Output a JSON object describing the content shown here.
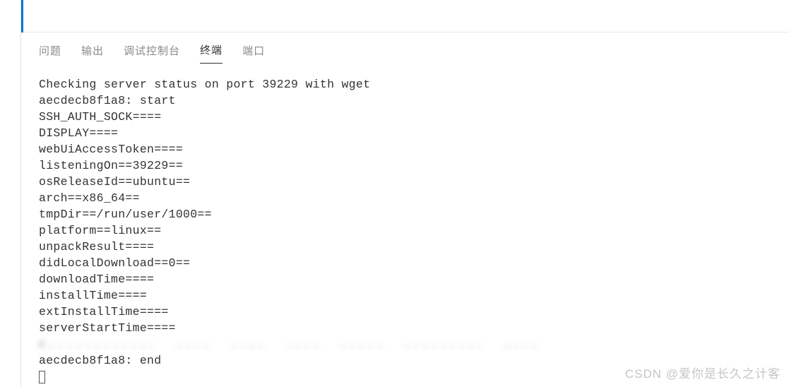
{
  "tabs": {
    "problems": "问题",
    "output": "输出",
    "debugConsole": "调试控制台",
    "terminal": "终端",
    "ports": "端口"
  },
  "terminal": {
    "line1": "Checking server status on port 39229 with wget",
    "line2": "aecdecb8f1a8: start",
    "line3": "SSH_AUTH_SOCK====",
    "line4": "DISPLAY====",
    "line5": "webUiAccessToken====",
    "line6": "listeningOn==39229==",
    "line7": "osReleaseId==ubuntu==",
    "line8": "arch==x86_64==",
    "line9": "tmpDir==/run/user/1000==",
    "line10": "platform==linux==",
    "line11": "unpackResult====",
    "line12": "didLocalDownload==0==",
    "line13": "downloadTime====",
    "line14": "installTime====",
    "line15": "extInstallTime====",
    "line16": "serverStartTime====",
    "line17_blurred": "c............  ....  ....  ....  .....  .........  ....",
    "line18": "aecdecb8f1a8: end"
  },
  "watermark": "CSDN @爱你是长久之计客"
}
